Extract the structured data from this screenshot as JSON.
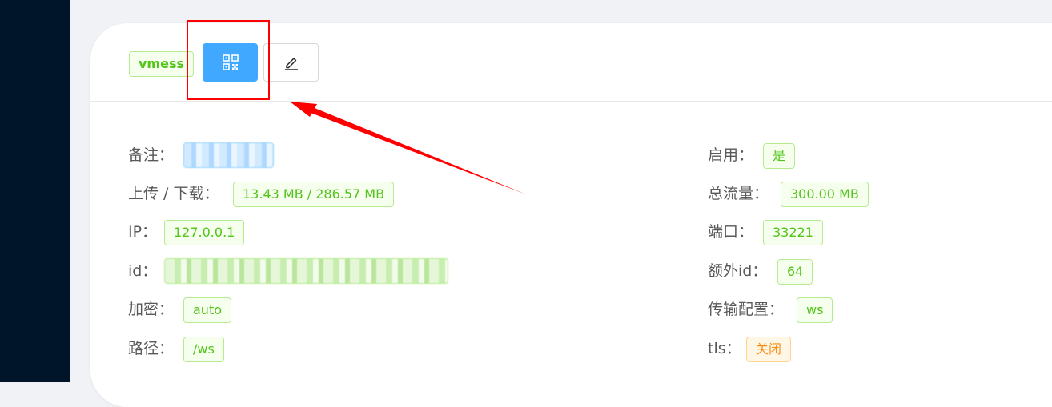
{
  "inbound": {
    "protocol": "vmess",
    "buttons": {
      "qrcode_icon": "qrcode-icon",
      "edit_icon": "edit-icon"
    },
    "left_fields": [
      {
        "label": "备注：",
        "value": ""
      },
      {
        "label": "上传 / 下载：",
        "value": "13.43 MB / 286.57 MB"
      },
      {
        "label": "IP：",
        "value": "127.0.0.1"
      },
      {
        "label": "id：",
        "value": ""
      },
      {
        "label": "加密：",
        "value": "auto"
      },
      {
        "label": "路径：",
        "value": "/ws"
      }
    ],
    "right_fields": [
      {
        "label": "启用：",
        "value": "是"
      },
      {
        "label": "总流量：",
        "value": "300.00 MB"
      },
      {
        "label": "端口：",
        "value": "33221"
      },
      {
        "label": "额外id：",
        "value": "64"
      },
      {
        "label": "传输配置：",
        "value": "ws"
      },
      {
        "label": "tls：",
        "value": "关闭"
      }
    ]
  },
  "colors": {
    "sidebar": "#001529",
    "primary": "#40a9ff",
    "tag_green": "#52c41a",
    "tag_orange": "#fa8c16",
    "annotation": "#ff0000"
  }
}
